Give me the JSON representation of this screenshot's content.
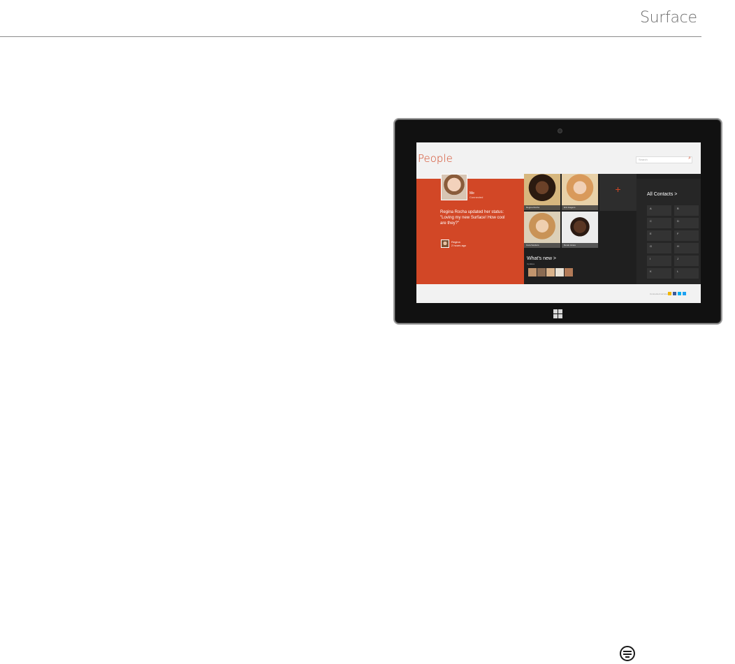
{
  "page": {
    "brand": "Surface"
  },
  "tablet": {
    "app": {
      "title": "People",
      "search_placeholder": "Search",
      "me": {
        "name": "Me",
        "subtitle": "Connected",
        "status": "Regina Rocha updated her status: \"Loving my new Surface! How cool are they?\"",
        "commenter_name": "Regina",
        "commenter_time": "2 hours ago"
      },
      "contacts": [
        {
          "name": "Regina Rocha",
          "photo_color": "#b4764f"
        },
        {
          "name": "Erin Hagens",
          "photo_color": "#e7b98f"
        },
        {
          "name": "Cara Sanders",
          "photo_color": "#d9b28a"
        },
        {
          "name": "Derek Jones",
          "photo_color": "#5a3a2a"
        }
      ],
      "add_label": "+",
      "whats_new": {
        "title": "What's new >",
        "subtitle": "Updates"
      },
      "all_contacts": {
        "title": "All Contacts >",
        "letters": [
          "A",
          "B",
          "C",
          "D",
          "E",
          "F",
          "G",
          "H",
          "I",
          "J",
          "K",
          "L"
        ]
      },
      "footer": {
        "label": "Connected services"
      }
    },
    "colors": {
      "accent": "#d24726",
      "dark": "#1f1f1f",
      "screen_bg": "#f2f2f2"
    }
  },
  "icons": {
    "windows": "windows-logo-icon",
    "search": "search-icon",
    "footer": "equal-housing-icon"
  }
}
